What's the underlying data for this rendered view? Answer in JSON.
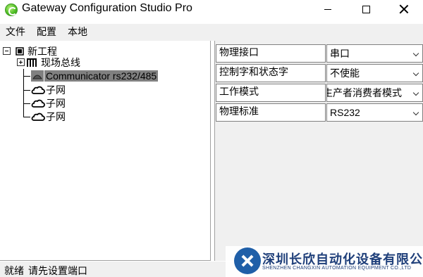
{
  "window": {
    "title": "Gateway Configuration Studio Pro"
  },
  "menu": {
    "items": [
      "文件",
      "配置",
      "本地"
    ]
  },
  "tree": {
    "root_label": "新工程",
    "fieldbus_label": "现场总线",
    "communicator_label": "Communicator rs232/485",
    "subnets": [
      "子网",
      "子网",
      "子网"
    ]
  },
  "properties": {
    "rows": [
      {
        "label": "物理接口",
        "value": "串口"
      },
      {
        "label": "控制字和状态字",
        "value": "不使能"
      },
      {
        "label": "工作模式",
        "value": "生产者消费者模式"
      },
      {
        "label": "物理标准",
        "value": "RS232"
      }
    ]
  },
  "status": {
    "ready": "就绪",
    "message": "请先设置端口"
  },
  "watermark": {
    "company_cn": "深圳长欣自动化设备有限公司",
    "company_en": "SHENZHEN CHANGXIN AUTOMATION EQUIPMENT CO.,LTD"
  },
  "colors": {
    "selection": "#808080",
    "brand": "#1f5fa8"
  },
  "icons": [
    "app-icon",
    "minimize-icon",
    "maximize-icon",
    "close-icon",
    "project-icon",
    "fieldbus-icon",
    "communicator-icon",
    "cloud-icon",
    "dropdown-arrow-icon"
  ]
}
